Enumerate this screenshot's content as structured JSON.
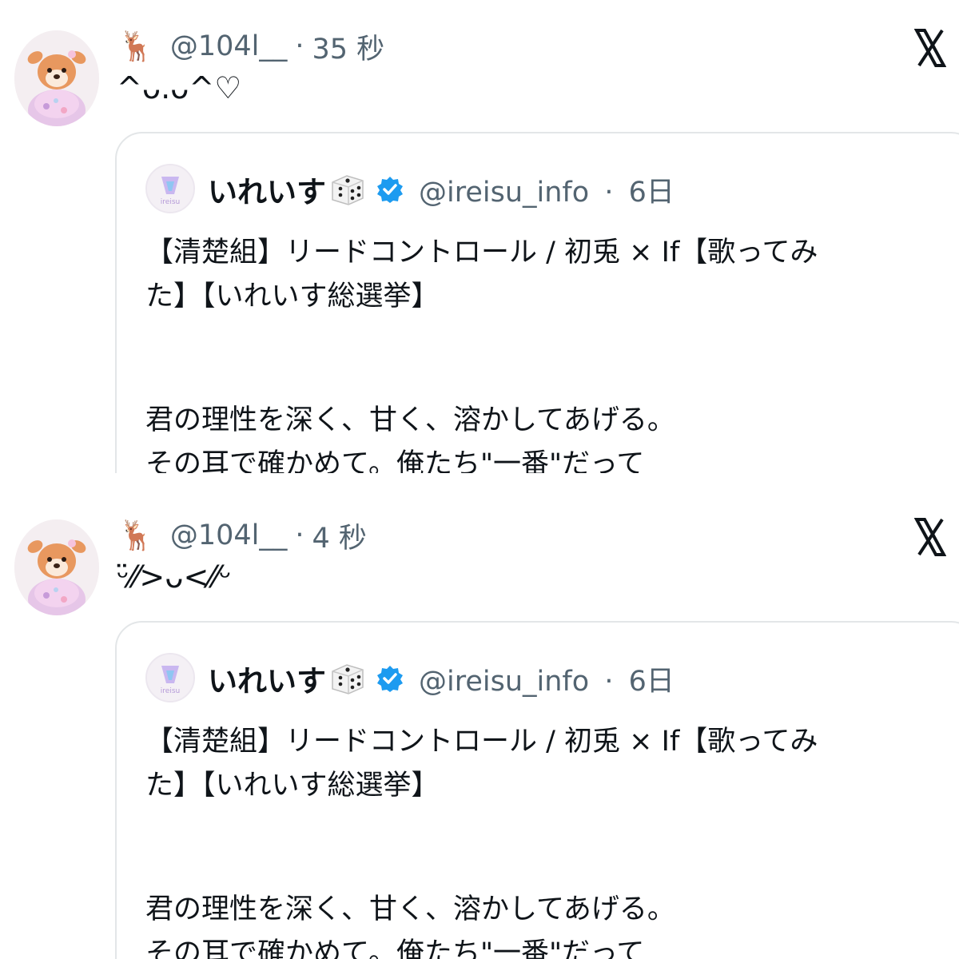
{
  "tweets": [
    {
      "user_emoji": "🦌",
      "handle": "@104l__",
      "separator": "·",
      "time": "35 秒",
      "text": "^ᴗ.ᴗ^♡",
      "quote": {
        "name": "いれいす",
        "name_emoji": "dice",
        "handle": "@ireisu_info",
        "separator": "·",
        "time": "6日",
        "lines": [
          "【清楚組】リードコントロール / 初兎 × If【歌ってみ",
          "た】【いれいす総選挙】",
          "君の理性を深く、甘く、溶かしてあげる。",
          "その耳で確かめて。俺たち\"一番\"だって"
        ]
      }
    },
    {
      "user_emoji": "🦌",
      "handle": "@104l__",
      "separator": "·",
      "time": "4 秒",
      "text": "ᵕ̈⁄⁄>ᴗ<⁄⁄ᵕ",
      "quote": {
        "name": "いれいす",
        "name_emoji": "dice",
        "handle": "@ireisu_info",
        "separator": "·",
        "time": "6日",
        "lines": [
          "【清楚組】リードコントロール / 初兎 × If【歌ってみ",
          "た】【いれいす総選挙】",
          "君の理性を深く、甘く、溶かしてあげる。",
          "その耳で確かめて。俺たち\"一番\"だって"
        ]
      }
    }
  ],
  "icons": {
    "share": "x-logo-icon",
    "verified": "verified-badge-icon",
    "dice": "dice-icon"
  },
  "colors": {
    "text": "#0f1419",
    "secondary": "#536471",
    "verified": "#1d9bf0",
    "border": "#e3e6e8"
  }
}
